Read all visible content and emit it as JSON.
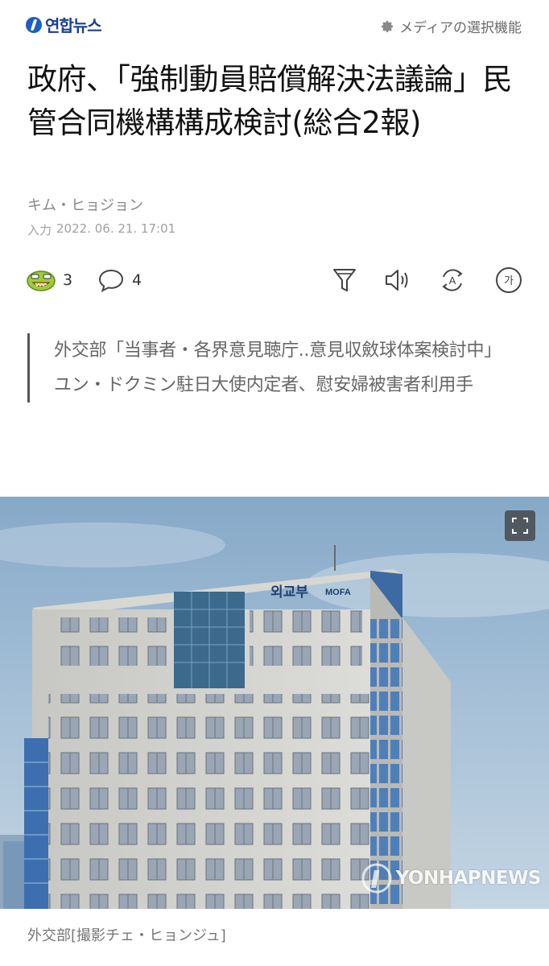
{
  "header": {
    "logo_text": "연합뉴스",
    "media_settings_label": "メディアの選択機能"
  },
  "article": {
    "headline": "政府、「強制動員賠償解決法議論」民管合同機構構成検討(総合2報)",
    "author": "キム・ヒョジョン",
    "date_label": "入力",
    "date_value": "2022. 06. 21. 17:01",
    "summary": [
      "外交部「当事者・各界意見聴庁..意見収斂球体案検討中」",
      "ユン・ドクミン駐日大使内定者、慰安婦被害者利用手"
    ]
  },
  "actions": {
    "reaction_count": "3",
    "comment_count": "4"
  },
  "icons": {
    "reaction": "reaction-face-icon",
    "comment": "comment-bubble-icon",
    "filter": "filter-icon",
    "tts": "speaker-icon",
    "translate": "translate-icon",
    "font_size": "font-size-icon",
    "expand": "expand-icon",
    "settings": "gear-icon"
  },
  "photo": {
    "sign_korean": "외교부",
    "sign_english": "MOFA",
    "watermark": "YONHAPNEWS"
  },
  "caption": "外交部[撮影チェ・ヒョンジュ]",
  "font_button_label": "가",
  "translate_label": "A",
  "colors": {
    "brand": "#1b5fc4",
    "text": "#111111",
    "muted": "#888888"
  }
}
